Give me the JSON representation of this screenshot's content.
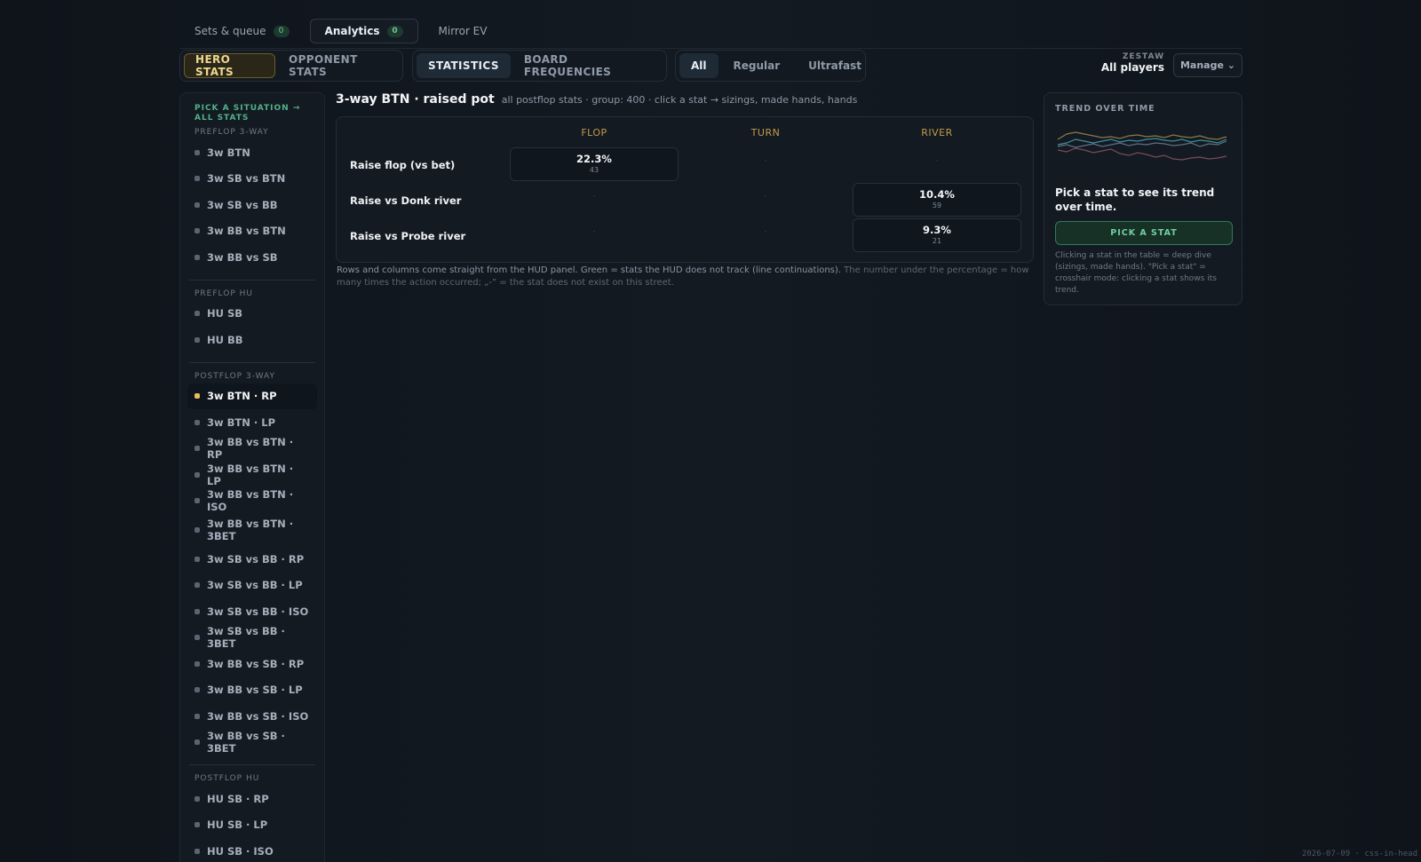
{
  "top_tabs": [
    {
      "label": "Sets & queue",
      "badge": "0"
    },
    {
      "label": "Analytics",
      "badge": "0"
    },
    {
      "label": "Mirror EV"
    }
  ],
  "stats_mode": [
    "HERO STATS",
    "OPPONENT STATS"
  ],
  "view_mode": [
    "STATISTICS",
    "BOARD FREQUENCIES"
  ],
  "speed_filter": [
    "All",
    "Regular",
    "Ultrafast"
  ],
  "player": {
    "label": "ZESTAW",
    "value": "All players"
  },
  "manage_label": "Manage ⌄",
  "sidebar": {
    "hint": "PICK A SITUATION → ALL STATS",
    "sections": [
      {
        "title": "PREFLOP 3-WAY",
        "items": [
          "3w BTN",
          "3w SB vs BTN",
          "3w SB vs BB",
          "3w BB vs BTN",
          "3w BB vs SB"
        ]
      },
      {
        "title": "PREFLOP HU",
        "items": [
          "HU SB",
          "HU BB"
        ]
      },
      {
        "title": "POSTFLOP 3-WAY",
        "items": [
          "3w BTN · RP",
          "3w BTN · LP",
          "3w BB vs BTN · RP",
          "3w BB vs BTN · LP",
          "3w BB vs BTN · ISO",
          "3w BB vs BTN · 3BET",
          "3w SB vs BB · RP",
          "3w SB vs BB · LP",
          "3w SB vs BB · ISO",
          "3w SB vs BB · 3BET",
          "3w BB vs SB · RP",
          "3w BB vs SB · LP",
          "3w BB vs SB · ISO",
          "3w BB vs SB · 3BET"
        ]
      },
      {
        "title": "POSTFLOP HU",
        "items": [
          "HU SB · RP",
          "HU SB · LP",
          "HU SB · ISO"
        ]
      }
    ],
    "active": "3w BTN · RP"
  },
  "main": {
    "title": "3-way BTN · raised pot",
    "subtitle": "all postflop stats · group: 400 · click a stat → sizings, made hands, hands",
    "columns": [
      "FLOP",
      "TURN",
      "RIVER"
    ],
    "rows": [
      {
        "label": "Raise flop (vs bet)",
        "flop": {
          "pct": "22.3%",
          "n": "43"
        },
        "turn": "-",
        "river": "-"
      },
      {
        "label": "Raise vs Donk river",
        "flop": "-",
        "turn": "-",
        "river": {
          "pct": "10.4%",
          "n": "59"
        }
      },
      {
        "label": "Raise vs Probe river",
        "flop": "-",
        "turn": "-",
        "river": {
          "pct": "9.3%",
          "n": "21"
        }
      }
    ],
    "note_main": "Rows and columns come straight from the HUD panel. Green = stats the HUD does not track (line continuations).",
    "note_muted": "The number under the percentage = how many times the action occurred; „-” = the stat does not exist on this street."
  },
  "trend": {
    "title": "TREND OVER TIME",
    "message": "Pick a stat to see its trend over time.",
    "button": "PICK A STAT",
    "help": "Clicking a stat in the table = deep dive (sizings, made hands). \"Pick a stat\" = crosshair mode: clicking a stat shows its trend.",
    "line_colors": [
      "#8a7a4a",
      "#3d8fa0",
      "#7a4a5e",
      "#5f6f86"
    ]
  },
  "stamp": "2026-07-09 · css-in-head"
}
